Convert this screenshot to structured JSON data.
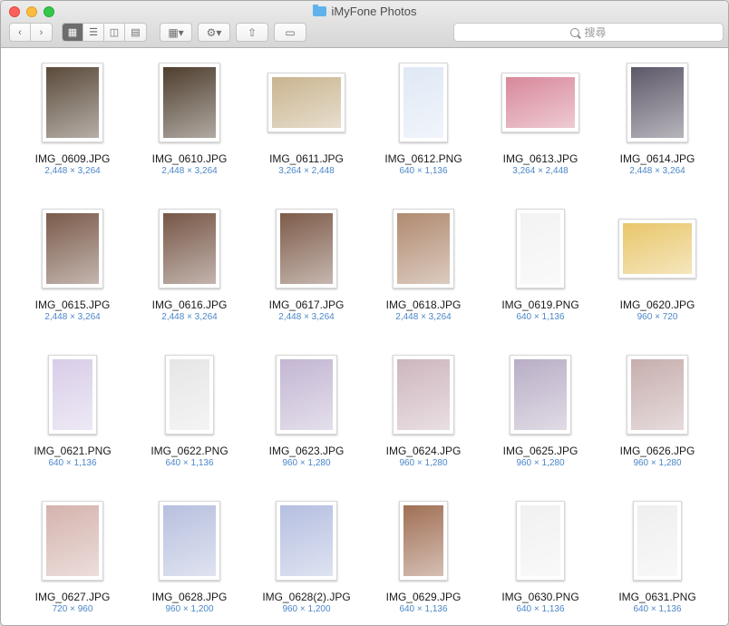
{
  "window": {
    "title": "iMyFone Photos"
  },
  "toolbar": {
    "back_icon": "chevron-left-icon",
    "forward_icon": "chevron-right-icon",
    "view_modes": [
      "icon-view",
      "list-view",
      "column-view",
      "cover-flow-view"
    ],
    "arrange_icon": "arrange-grid-icon",
    "action_icon": "gear-icon",
    "share_icon": "share-icon",
    "tag_icon": "tag-icon",
    "search_placeholder": "搜尋"
  },
  "files": [
    {
      "name": "IMG_0609.JPG",
      "dims": "2,448 × 3,264",
      "color": "#5a4a3a",
      "orient": "portrait"
    },
    {
      "name": "IMG_0610.JPG",
      "dims": "2,448 × 3,264",
      "color": "#4e3e2e",
      "orient": "portrait"
    },
    {
      "name": "IMG_0611.JPG",
      "dims": "3,264 × 2,448",
      "color": "#c9b48f",
      "orient": "landscape"
    },
    {
      "name": "IMG_0612.PNG",
      "dims": "640 × 1,136",
      "color": "#dfe8f5",
      "orient": "tall"
    },
    {
      "name": "IMG_0613.JPG",
      "dims": "3,264 × 2,448",
      "color": "#d8889a",
      "orient": "landscape"
    },
    {
      "name": "IMG_0614.JPG",
      "dims": "2,448 × 3,264",
      "color": "#5d5868",
      "orient": "portrait"
    },
    {
      "name": "IMG_0615.JPG",
      "dims": "2,448 × 3,264",
      "color": "#7a5a4a",
      "orient": "portrait"
    },
    {
      "name": "IMG_0616.JPG",
      "dims": "2,448 × 3,264",
      "color": "#765646",
      "orient": "portrait"
    },
    {
      "name": "IMG_0617.JPG",
      "dims": "2,448 × 3,264",
      "color": "#7d5b49",
      "orient": "portrait"
    },
    {
      "name": "IMG_0618.JPG",
      "dims": "2,448 × 3,264",
      "color": "#b08a70",
      "orient": "portrait"
    },
    {
      "name": "IMG_0619.PNG",
      "dims": "640 × 1,136",
      "color": "#f3f3f3",
      "orient": "tall"
    },
    {
      "name": "IMG_0620.JPG",
      "dims": "960 × 720",
      "color": "#e8c66a",
      "orient": "landscape"
    },
    {
      "name": "IMG_0621.PNG",
      "dims": "640 × 1,136",
      "color": "#d8cde8",
      "orient": "tall"
    },
    {
      "name": "IMG_0622.PNG",
      "dims": "640 × 1,136",
      "color": "#e6e6e6",
      "orient": "tall"
    },
    {
      "name": "IMG_0623.JPG",
      "dims": "960 × 1,280",
      "color": "#c3b6d3",
      "orient": "portrait"
    },
    {
      "name": "IMG_0624.JPG",
      "dims": "960 × 1,280",
      "color": "#cdb6bd",
      "orient": "portrait"
    },
    {
      "name": "IMG_0625.JPG",
      "dims": "960 × 1,280",
      "color": "#b9aec6",
      "orient": "portrait"
    },
    {
      "name": "IMG_0626.JPG",
      "dims": "960 × 1,280",
      "color": "#c7aeae",
      "orient": "portrait"
    },
    {
      "name": "IMG_0627.JPG",
      "dims": "720 × 960",
      "color": "#d4b3ad",
      "orient": "portrait"
    },
    {
      "name": "IMG_0628.JPG",
      "dims": "960 × 1,200",
      "color": "#b7c0de",
      "orient": "portrait"
    },
    {
      "name": "IMG_0628(2).JPG",
      "dims": "960 × 1,200",
      "color": "#b5bfe0",
      "orient": "portrait"
    },
    {
      "name": "IMG_0629.JPG",
      "dims": "640 × 1,136",
      "color": "#a06f55",
      "orient": "tall"
    },
    {
      "name": "IMG_0630.PNG",
      "dims": "640 × 1,136",
      "color": "#f1f1f1",
      "orient": "tall"
    },
    {
      "name": "IMG_0631.PNG",
      "dims": "640 × 1,136",
      "color": "#efefef",
      "orient": "tall"
    }
  ]
}
